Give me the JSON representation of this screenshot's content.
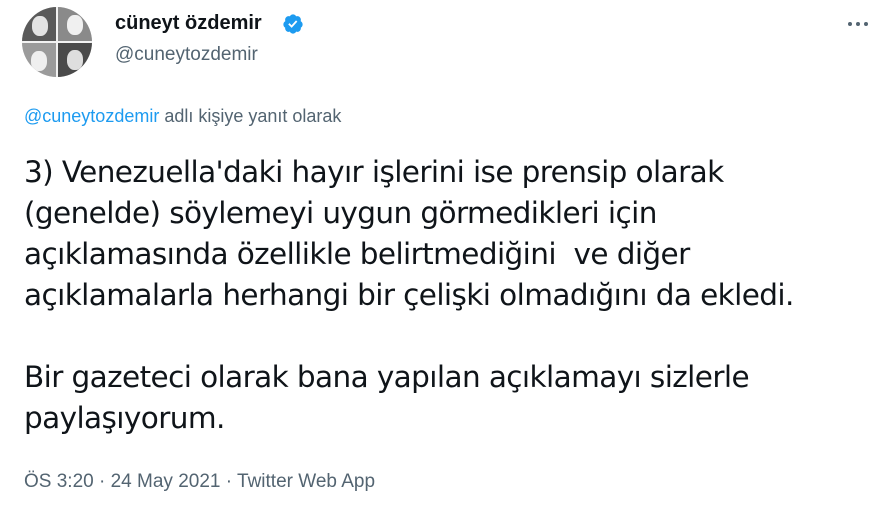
{
  "author": {
    "display_name": "cüneyt özdemir",
    "handle": "@cuneytozdemir",
    "verified_icon": "verified-badge-icon"
  },
  "reply": {
    "mention": "@cuneytozdemir",
    "suffix": " adlı kişiye yanıt olarak"
  },
  "tweet": {
    "lines": [
      "3) Venezuella'daki hayır işlerini ise prensip olarak",
      "(genelde) söylemeyi uygun görmedikleri için",
      "açıklamasında özellikle belirtmediğini  ve diğer",
      "açıklamalarla herhangi bir çelişki olmadığını da ekledi.",
      "Bir gazeteci olarak bana yapılan açıklamayı sizlerle",
      "paylaşıyorum."
    ]
  },
  "meta": {
    "time": "ÖS 3:20",
    "separator": " · ",
    "date": "24 May 2021",
    "source": "Twitter Web App"
  },
  "colors": {
    "accent": "#1d9bf0",
    "text": "#0f1419",
    "muted": "#536471"
  }
}
